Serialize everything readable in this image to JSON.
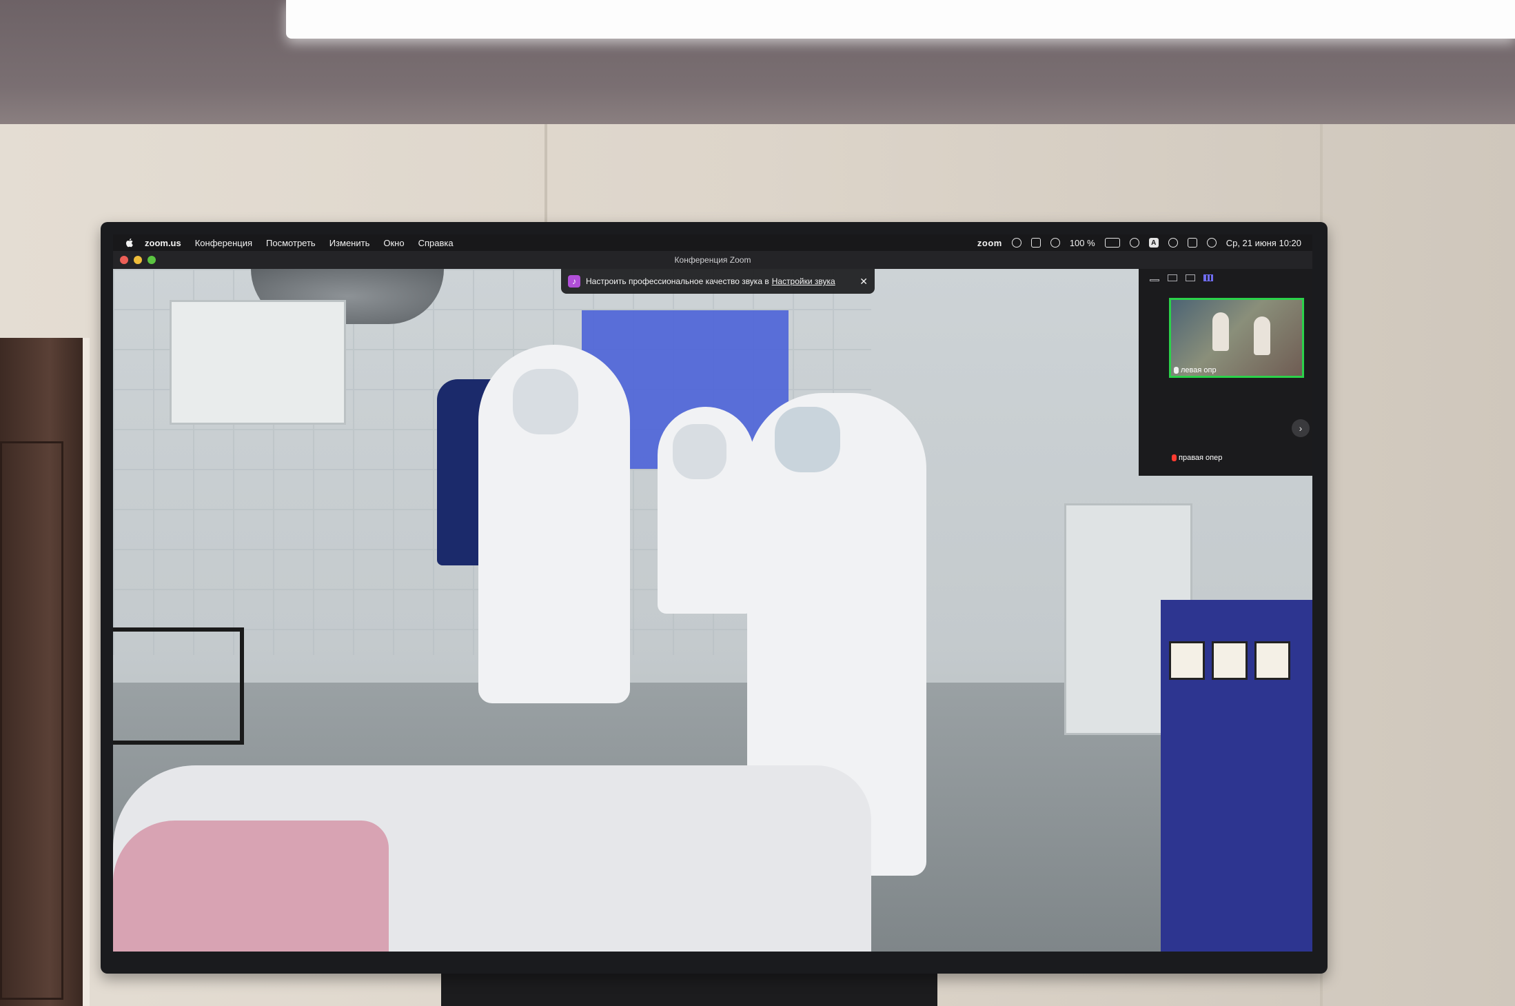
{
  "menubar": {
    "app_name": "zoom.us",
    "items": [
      "Конференция",
      "Посмотреть",
      "Изменить",
      "Окно",
      "Справка"
    ],
    "zoom_logo": "zoom",
    "battery": "100 %",
    "input_badge": "A",
    "clock": "Ср, 21 июня  10:20"
  },
  "window": {
    "title": "Конференция Zoom"
  },
  "notification": {
    "text": "Настроить профессиональное качество звука в",
    "link": "Настройки звука",
    "close": "✕"
  },
  "gallery": {
    "participants": [
      {
        "name": "левая опр",
        "active_speaker": true,
        "muted": false
      },
      {
        "name": "правая опер",
        "active_speaker": false,
        "muted": true
      }
    ],
    "next": "›"
  },
  "colors": {
    "active_speaker_border": "#2bd24a",
    "menubar_bg": "#18181a",
    "muted_mic": "#ff3b30",
    "audio_icon": "#b14fd8"
  }
}
